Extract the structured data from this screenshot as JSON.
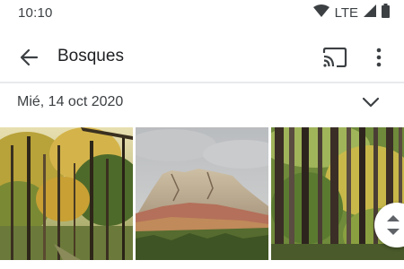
{
  "status_bar": {
    "time": "10:10",
    "network": "LTE",
    "icons": [
      "wifi-icon",
      "signal-icon",
      "battery-icon"
    ]
  },
  "app_bar": {
    "title": "Bosques",
    "icons": [
      "back-arrow-icon",
      "cast-icon",
      "more-vert-icon"
    ]
  },
  "date_group": {
    "label": "Mié, 14 oct 2020",
    "icon": "chevron-down-icon"
  },
  "photos": [
    {
      "subject": "autumn-forest"
    },
    {
      "subject": "mountain-peak"
    },
    {
      "subject": "tall-forest-trunks"
    }
  ],
  "colors": {
    "text_primary": "#202124",
    "text_secondary": "#3c4043",
    "divider": "#e8eaed",
    "background": "#ffffff"
  }
}
